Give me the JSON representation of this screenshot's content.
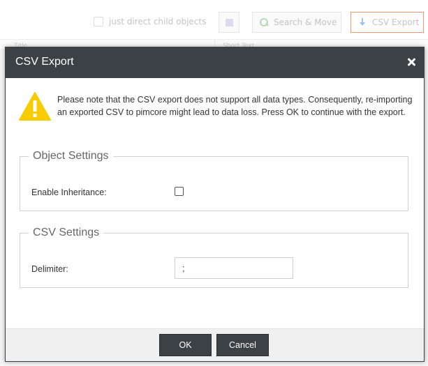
{
  "toolbar": {
    "direct_children_label": "just direct child objects",
    "search_move_label": "Search & Move",
    "csv_export_label": "CSV Export"
  },
  "grid": {
    "columns": [
      "Title",
      "Short Text"
    ]
  },
  "dialog": {
    "title": "CSV Export",
    "warning": "Please note that the CSV export does not support all data types. Consequently, re-importing an exported CSV to pimcore might lead to data loss. Press OK to continue with the export.",
    "object_settings": {
      "legend": "Object Settings",
      "inheritance_label": "Enable Inheritance:"
    },
    "csv_settings": {
      "legend": "CSV Settings",
      "delimiter_label": "Delimiter:",
      "delimiter_value": ";"
    },
    "ok_label": "OK",
    "cancel_label": "Cancel"
  },
  "colors": {
    "header_bg": "#3b4144",
    "warning_yellow": "#f7cc00",
    "accent_border": "#e89a6a"
  }
}
